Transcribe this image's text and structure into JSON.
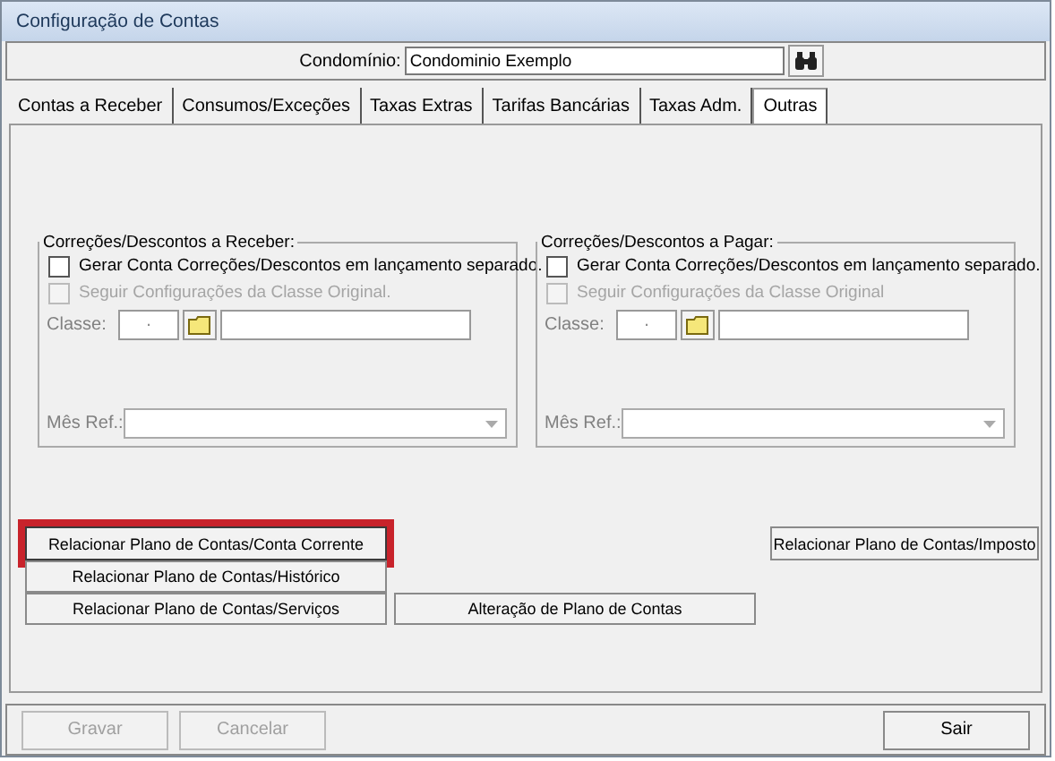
{
  "window": {
    "title": "Configuração de Contas"
  },
  "condominio": {
    "label": "Condomínio:",
    "value": "Condominio Exemplo"
  },
  "tabs": [
    {
      "label": "Contas a Receber",
      "selected": false
    },
    {
      "label": "Consumos/Exceções",
      "selected": false
    },
    {
      "label": "Taxas Extras",
      "selected": false
    },
    {
      "label": "Tarifas Bancárias",
      "selected": false
    },
    {
      "label": "Taxas Adm.",
      "selected": false
    },
    {
      "label": "Outras",
      "selected": true
    }
  ],
  "groups": [
    {
      "title": "Correções/Descontos a Receber:",
      "checks": [
        {
          "label": "Gerar Conta Correções/Descontos em lançamento separado.",
          "checked": false,
          "disabled": false
        },
        {
          "label": "Seguir Configurações da Classe Original.",
          "checked": false,
          "disabled": true
        }
      ],
      "classe_label": "Classe:",
      "classe_code": ".",
      "mes_label": "Mês Ref.:"
    },
    {
      "title": "Correções/Descontos a Pagar:",
      "checks": [
        {
          "label": "Gerar Conta Correções/Descontos em lançamento separado.",
          "checked": false,
          "disabled": false
        },
        {
          "label": "Seguir Configurações da Classe Original",
          "checked": false,
          "disabled": true
        }
      ],
      "classe_label": "Classe:",
      "classe_code": ".",
      "mes_label": "Mês Ref.:"
    }
  ],
  "actions": [
    {
      "label": "Relacionar Plano de Contas/Conta Corrente",
      "highlighted": true
    },
    {
      "label": "Relacionar Plano de Contas/Imposto",
      "highlighted": false
    },
    {
      "label": "Relacionar Plano de Contas/Histórico",
      "highlighted": false
    },
    {
      "label": "Relacionar Plano de Contas/Serviços",
      "highlighted": false
    },
    {
      "label": "Alteração de Plano de Contas",
      "highlighted": false
    }
  ],
  "footer": [
    {
      "label": "Gravar",
      "disabled": true
    },
    {
      "label": "Cancelar",
      "disabled": true
    },
    {
      "label": "Sair",
      "disabled": false
    }
  ]
}
